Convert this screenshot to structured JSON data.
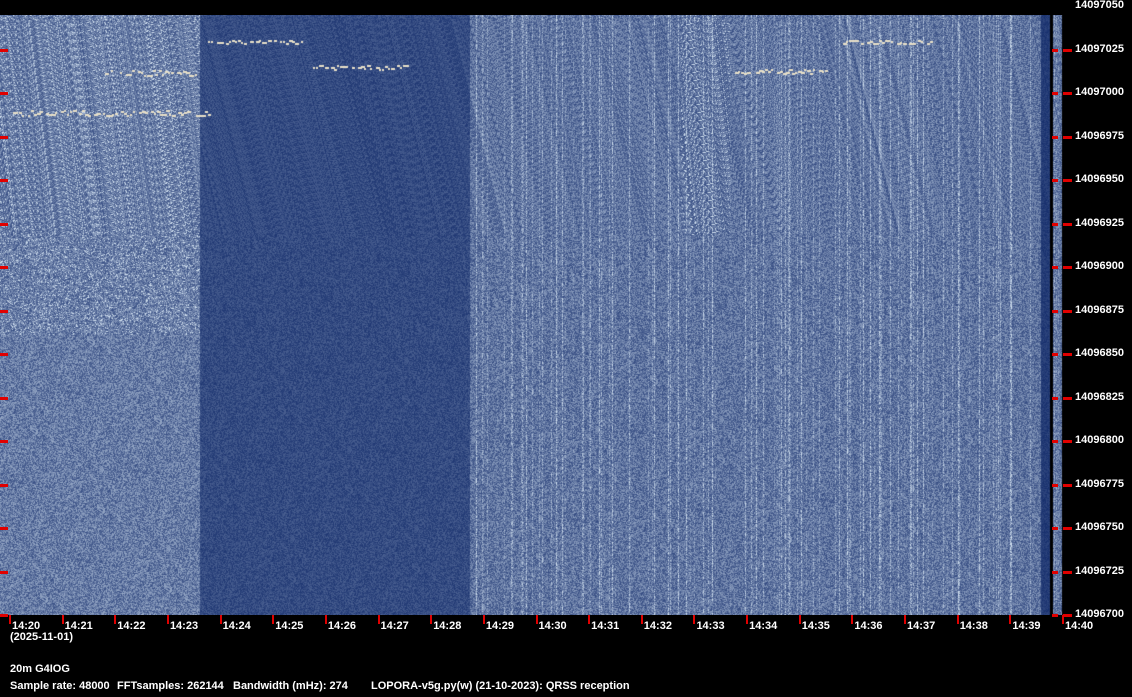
{
  "chart_data": {
    "type": "heatmap",
    "title": "QRSS waterfall spectrogram",
    "x_ticks": [
      "14:20",
      "14:21",
      "14:22",
      "14:23",
      "14:24",
      "14:25",
      "14:26",
      "14:27",
      "14:28",
      "14:29",
      "14:30",
      "14:31",
      "14:32",
      "14:33",
      "14:34",
      "14:35",
      "14:36",
      "14:37",
      "14:38",
      "14:39",
      "14:40"
    ],
    "x_date": "(2025-11-01)",
    "y_ticks": [
      "14097050",
      "14097025",
      "14097000",
      "14096975",
      "14096950",
      "14096925",
      "14096900",
      "14096875",
      "14096850",
      "14096825",
      "14096800",
      "14096775",
      "14096750",
      "14096725",
      "14096700"
    ],
    "ylim": [
      14096700,
      14097050
    ],
    "colors": {
      "background": "#0a2766",
      "tick": "#e00000",
      "signal": "#e8e0c8"
    }
  },
  "footer": {
    "station": "20m G4IOG",
    "sample_rate": "Sample rate: 48000",
    "fft_samples": "FFTsamples: 262144",
    "bandwidth": "Bandwidth (mHz): 274",
    "software": "LOPORA-v5g.py(w) (21-10-2023): QRSS reception"
  }
}
